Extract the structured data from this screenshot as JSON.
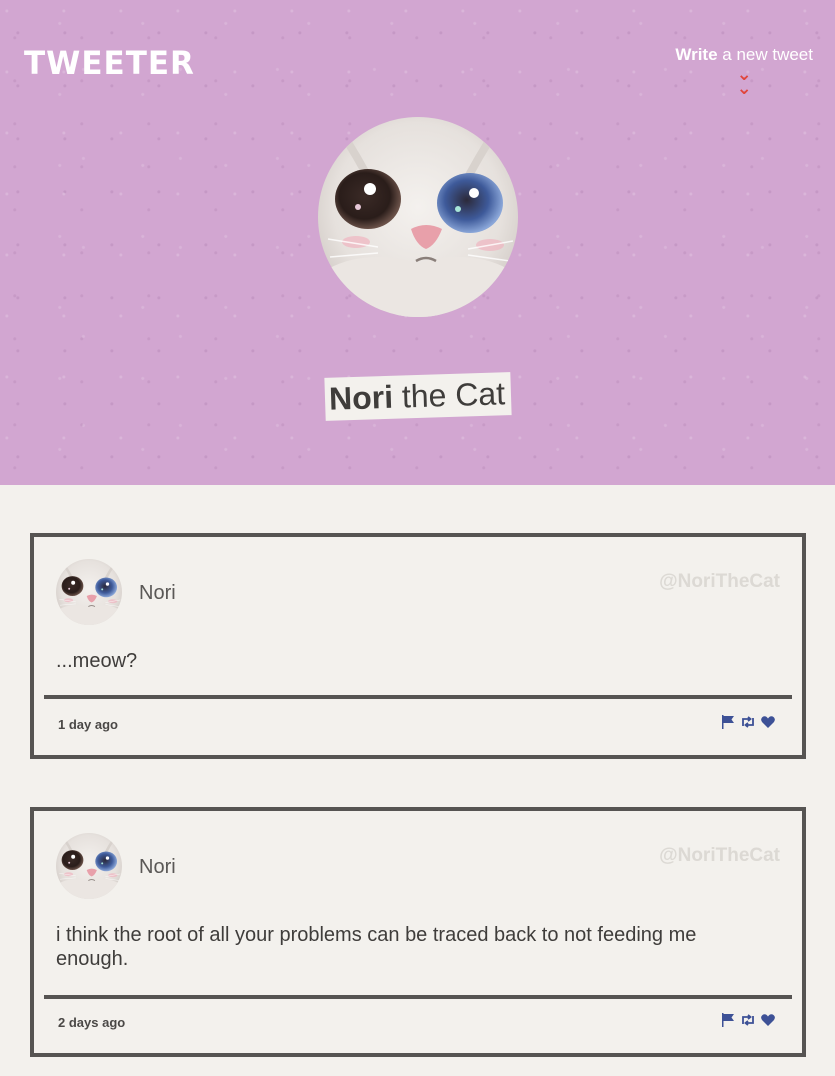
{
  "header": {
    "logo": "TWEETER",
    "compose_bold": "Write",
    "compose_rest": " a new tweet",
    "compose_icon": "double-chevron-down-icon",
    "profile_first": "Nori",
    "profile_rest": " the Cat"
  },
  "colors": {
    "hero_bg": "#d2a6d1",
    "page_bg": "#f3f1ed",
    "accent_red": "#e0453b",
    "icon_blue": "#3d5196",
    "border": "#565452"
  },
  "tweets": [
    {
      "name": "Nori",
      "handle": "@NoriTheCat",
      "text": "...meow?",
      "time": "1 day ago",
      "actions": [
        "flag-icon",
        "retweet-icon",
        "heart-icon"
      ]
    },
    {
      "name": "Nori",
      "handle": "@NoriTheCat",
      "text": "i think the root of all your problems can be traced back to not feeding me enough.",
      "time": "2 days ago",
      "actions": [
        "flag-icon",
        "retweet-icon",
        "heart-icon"
      ]
    }
  ]
}
